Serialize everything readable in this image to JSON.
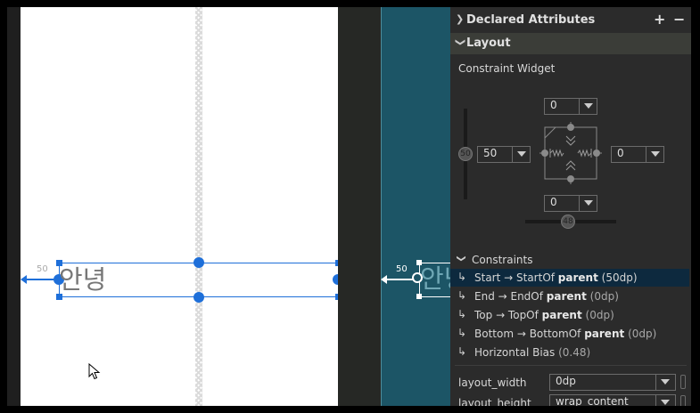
{
  "design": {
    "text_value": "안녕",
    "margin_label": "50"
  },
  "blueprint": {
    "text_value": "안녕",
    "margin_label": "50"
  },
  "panel": {
    "declared_header": "Declared Attributes",
    "add_icon": "+",
    "remove_icon": "−",
    "layout_header": "Layout",
    "widget_title": "Constraint Widget",
    "top_margin": "0",
    "left_margin": "50",
    "right_margin": "0",
    "bottom_margin": "0",
    "vertical_bias": "50",
    "horizontal_bias": "48",
    "constraints_header": "Constraints",
    "constraints": [
      {
        "prefix": "Start → StartOf ",
        "parent": "parent",
        "value": "(50dp)"
      },
      {
        "prefix": "End → EndOf ",
        "parent": "parent",
        "value": "(0dp)"
      },
      {
        "prefix": "Top → TopOf ",
        "parent": "parent",
        "value": "(0dp)"
      },
      {
        "prefix": "Bottom → BottomOf ",
        "parent": "parent",
        "value": "(0dp)"
      },
      {
        "prefix": "Horizontal Bias ",
        "parent": "",
        "value": "(0.48)"
      }
    ],
    "layout_width_label": "layout_width",
    "layout_width_value": "0dp",
    "layout_height_label": "layout_height",
    "layout_height_value": "wrap_content"
  },
  "colors": {
    "accent": "#1e6fd9",
    "panel_bg": "#2b2b2b",
    "blueprint_bg": "#1c5566",
    "selection": "#0d293e"
  }
}
